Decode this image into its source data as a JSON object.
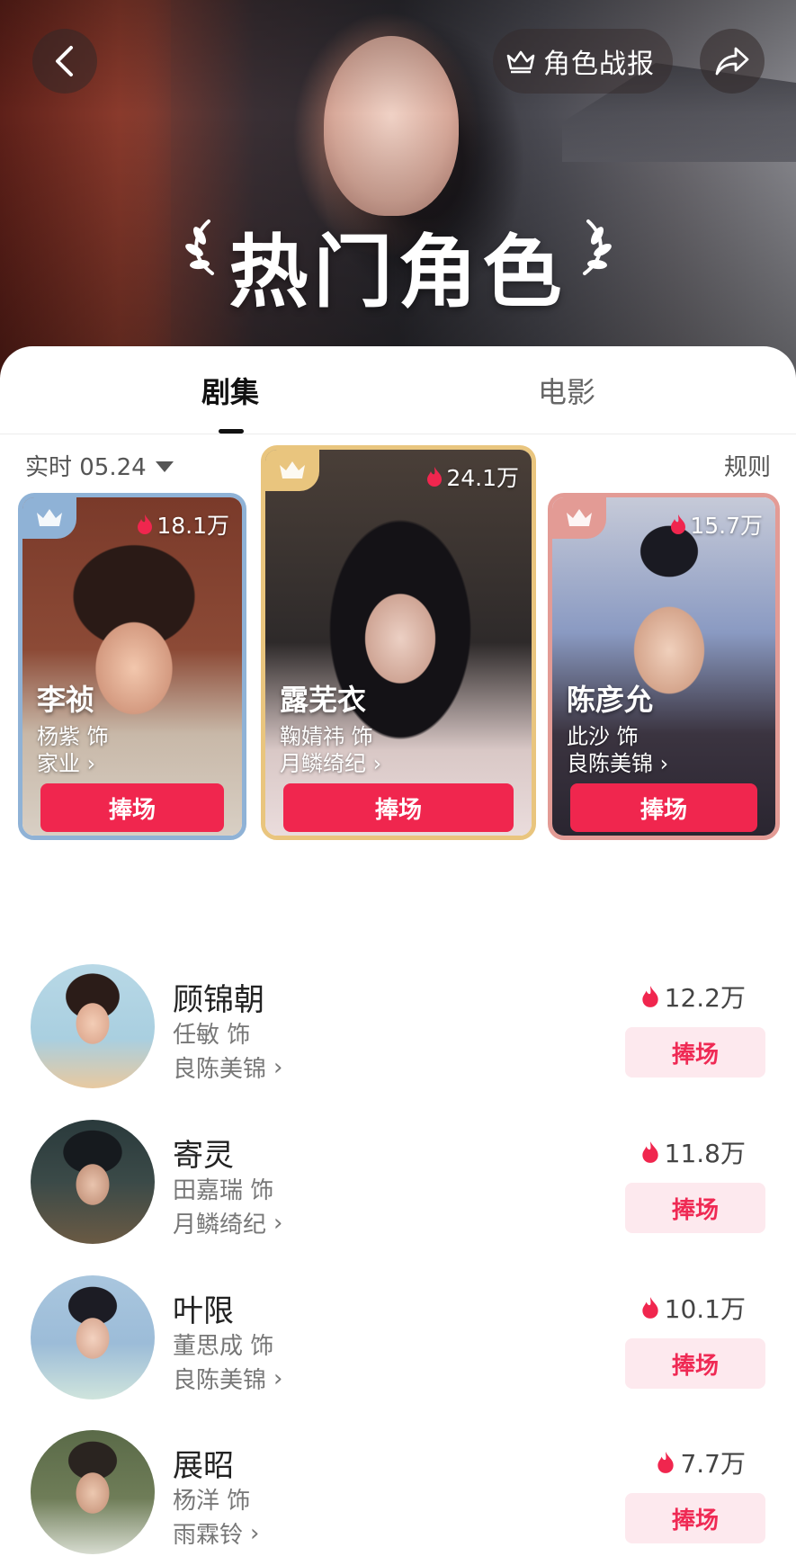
{
  "header": {
    "report_label": "角色战报",
    "title": "热门角色"
  },
  "tabs": [
    {
      "label": "剧集",
      "active": true
    },
    {
      "label": "电影",
      "active": false
    }
  ],
  "filter": {
    "label": "实时 05.24",
    "rules": "规则"
  },
  "top_cards": [
    {
      "rank": 2,
      "name": "李祯",
      "actor": "杨紫 饰",
      "show": "家业",
      "heat": "18.1万",
      "button": "捧场",
      "crown_color": "#8fb2d6"
    },
    {
      "rank": 1,
      "name": "露芜衣",
      "actor": "鞠婧祎 饰",
      "show": "月鳞绮纪",
      "heat": "24.1万",
      "button": "捧场",
      "crown_color": "#e9c57e"
    },
    {
      "rank": 3,
      "name": "陈彦允",
      "actor": "此沙 饰",
      "show": "良陈美锦",
      "heat": "15.7万",
      "button": "捧场",
      "crown_color": "#e39b95"
    }
  ],
  "list": [
    {
      "name": "顾锦朝",
      "actor": "任敏 饰",
      "show": "良陈美锦",
      "heat": "12.2万",
      "button": "捧场"
    },
    {
      "name": "寄灵",
      "actor": "田嘉瑞 饰",
      "show": "月鳞绮纪",
      "heat": "11.8万",
      "button": "捧场"
    },
    {
      "name": "叶限",
      "actor": "董思成 饰",
      "show": "良陈美锦",
      "heat": "10.1万",
      "button": "捧场"
    },
    {
      "name": "展昭",
      "actor": "杨洋 饰",
      "show": "雨霖铃",
      "heat": "7.7万",
      "button": "捧场"
    }
  ],
  "colors": {
    "accent": "#f0264e",
    "soft_button": "#fde9ee"
  }
}
